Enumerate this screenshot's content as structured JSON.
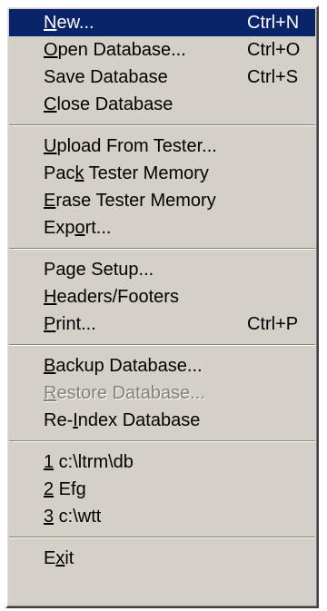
{
  "menu": {
    "groups": [
      [
        {
          "pre": "",
          "ul": "N",
          "post": "ew...",
          "shortcut": "Ctrl+N",
          "state": "highlighted"
        },
        {
          "pre": "",
          "ul": "O",
          "post": "pen Database...",
          "shortcut": "Ctrl+O",
          "state": "normal"
        },
        {
          "pre": "Save Database",
          "ul": "",
          "post": "",
          "shortcut": "Ctrl+S",
          "state": "normal"
        },
        {
          "pre": "",
          "ul": "C",
          "post": "lose Database",
          "shortcut": "",
          "state": "normal"
        }
      ],
      [
        {
          "pre": "",
          "ul": "U",
          "post": "pload From Tester...",
          "shortcut": "",
          "state": "normal"
        },
        {
          "pre": "Pac",
          "ul": "k",
          "post": " Tester Memory",
          "shortcut": "",
          "state": "normal"
        },
        {
          "pre": "",
          "ul": "E",
          "post": "rase Tester Memory",
          "shortcut": "",
          "state": "normal"
        },
        {
          "pre": "Exp",
          "ul": "o",
          "post": "rt...",
          "shortcut": "",
          "state": "normal"
        }
      ],
      [
        {
          "pre": "Pa",
          "ul": "g",
          "post": "e Setup...",
          "shortcut": "",
          "state": "normal"
        },
        {
          "pre": "",
          "ul": "H",
          "post": "eaders/Footers",
          "shortcut": "",
          "state": "normal"
        },
        {
          "pre": "",
          "ul": "P",
          "post": "rint...",
          "shortcut": "Ctrl+P",
          "state": "normal"
        }
      ],
      [
        {
          "pre": "",
          "ul": "B",
          "post": "ackup Database...",
          "shortcut": "",
          "state": "normal"
        },
        {
          "pre": "",
          "ul": "R",
          "post": "estore Database...",
          "shortcut": "",
          "state": "disabled"
        },
        {
          "pre": "Re-",
          "ul": "I",
          "post": "ndex Database",
          "shortcut": "",
          "state": "normal"
        }
      ],
      [
        {
          "pre": "",
          "ul": "1",
          "post": " c:\\ltrm\\db",
          "shortcut": "",
          "state": "normal"
        },
        {
          "pre": "",
          "ul": "2",
          "post": " Efg",
          "shortcut": "",
          "state": "normal"
        },
        {
          "pre": "",
          "ul": "3",
          "post": " c:\\wtt",
          "shortcut": "",
          "state": "normal"
        }
      ],
      [
        {
          "pre": "E",
          "ul": "x",
          "post": "it",
          "shortcut": "",
          "state": "normal"
        }
      ]
    ]
  }
}
